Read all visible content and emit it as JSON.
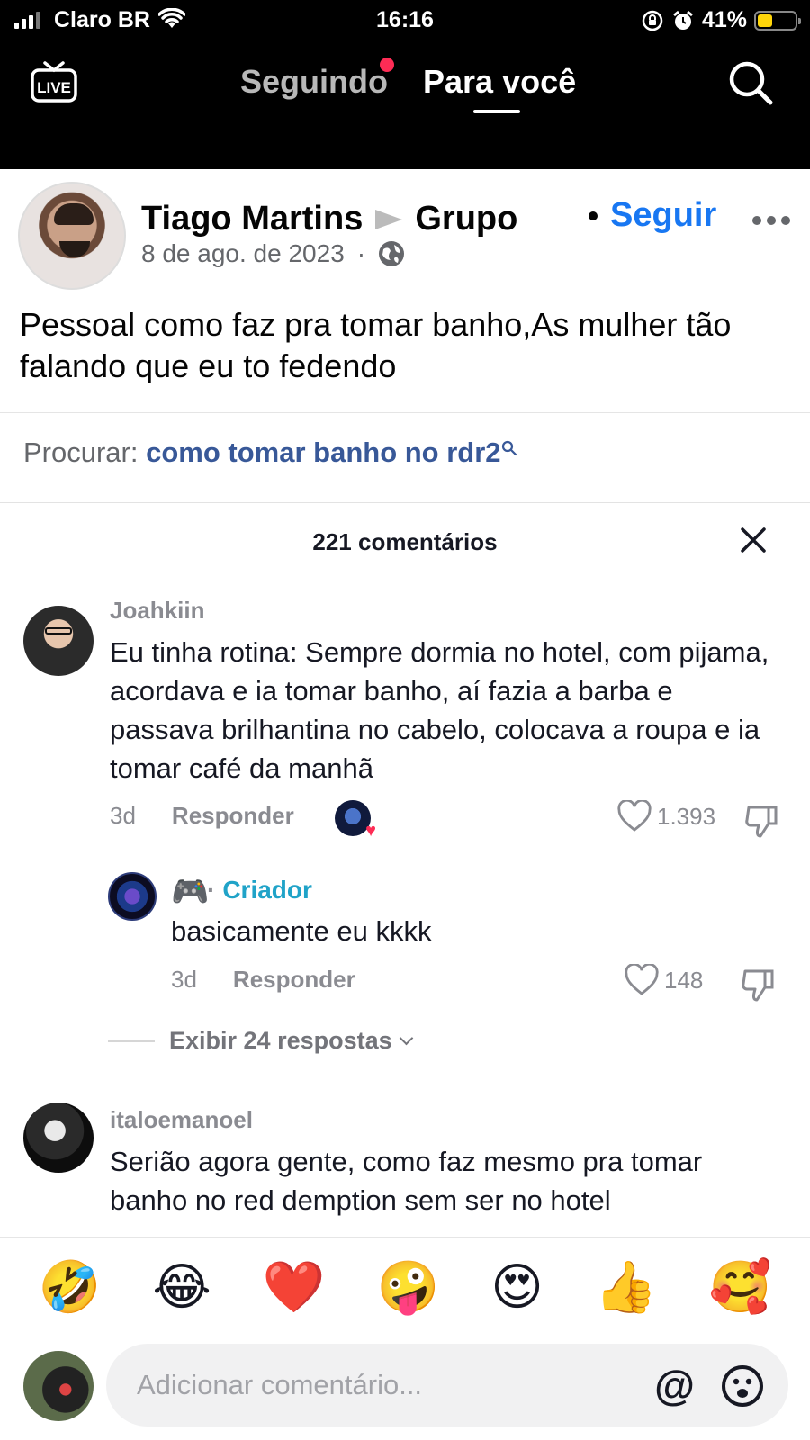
{
  "status_bar": {
    "carrier": "Claro BR",
    "time": "16:16",
    "battery_percent": "41%",
    "battery_level": 0.41
  },
  "header": {
    "tabs": [
      {
        "label": "Seguindo",
        "active": false,
        "has_notification_dot": true
      },
      {
        "label": "Para você",
        "active": true
      }
    ],
    "live_label": "LIVE"
  },
  "post": {
    "author": "Tiago Martins",
    "destination": "Grupo",
    "date": "8 de ago. de 2023",
    "date_separator": "·",
    "follow_label": "Seguir",
    "text": "Pessoal como faz pra tomar banho,As mulher tão falando que eu to fedendo",
    "search_prefix": "Procurar:",
    "search_query": "como tomar banho no rdr2"
  },
  "comments_sheet": {
    "title": "221 comentários",
    "comments": [
      {
        "username": "Joahkiin",
        "text": "Eu tinha rotina: Sempre dormia no hotel, com pijama, acordava e ia tomar banho, aí fazia a barba e passava brilhantina no cabelo, colocava a roupa e ia tomar café da manhã",
        "time": "3d",
        "reply_label": "Responder",
        "likes": "1.393",
        "liked_by_creator": true,
        "replies": [
          {
            "username_emoji": "🎮",
            "creator_label": "Criador",
            "separator": "·",
            "text": "basicamente eu kkkk",
            "time": "3d",
            "reply_label": "Responder",
            "likes": "148"
          }
        ],
        "view_replies_label": "Exibir 24 respostas"
      },
      {
        "username": "italoemanoel",
        "text": "Serião agora gente, como faz mesmo pra tomar banho no red demption sem ser no hotel"
      }
    ]
  },
  "composer": {
    "quick_emojis": [
      "🤣",
      "😂",
      "❤️",
      "🤪",
      "😍",
      "👍",
      "🥰"
    ],
    "placeholder": "Adicionar comentário...",
    "mention_label": "@"
  },
  "colors": {
    "accent_red": "#fe2c55",
    "follow_blue": "#1877f2",
    "creator_cyan": "#20a3c8",
    "battery_yellow": "#ffd60a"
  }
}
